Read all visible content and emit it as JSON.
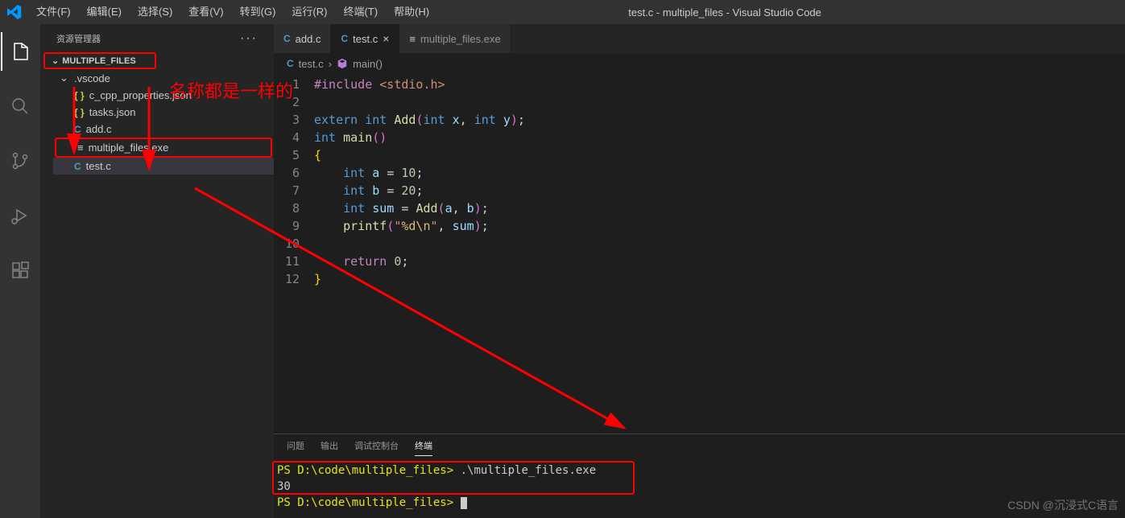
{
  "titlebar": {
    "menu": [
      "文件(F)",
      "编辑(E)",
      "选择(S)",
      "查看(V)",
      "转到(G)",
      "运行(R)",
      "终端(T)",
      "帮助(H)"
    ],
    "title": "test.c - multiple_files - Visual Studio Code"
  },
  "sidebar": {
    "header": "资源管理器",
    "folder": "MULTIPLE_FILES",
    "items": [
      {
        "name": ".vscode",
        "type": "folder"
      },
      {
        "name": "c_cpp_properties.json",
        "type": "json"
      },
      {
        "name": "tasks.json",
        "type": "json"
      },
      {
        "name": "add.c",
        "type": "c"
      },
      {
        "name": "multiple_files.exe",
        "type": "exe"
      },
      {
        "name": "test.c",
        "type": "c"
      }
    ]
  },
  "tabs": [
    {
      "label": "add.c",
      "icon": "c",
      "active": false
    },
    {
      "label": "test.c",
      "icon": "c",
      "active": true
    },
    {
      "label": "multiple_files.exe",
      "icon": "exe",
      "active": false,
      "italic": true
    }
  ],
  "breadcrumb": {
    "file": "test.c",
    "symbol": "main()"
  },
  "code_lines": [
    "1",
    "2",
    "3",
    "4",
    "5",
    "6",
    "7",
    "8",
    "9",
    "10",
    "11",
    "12"
  ],
  "panel": {
    "tabs": [
      "问题",
      "输出",
      "调试控制台",
      "终端"
    ],
    "active": "终端",
    "terminal": {
      "line1_prompt": "PS D:\\code\\multiple_files>",
      "line1_cmd": " .\\multiple_files.exe",
      "line2": "30",
      "line3_prompt": "PS D:\\code\\multiple_files>"
    }
  },
  "annotation_text": "名称都是一样的",
  "watermark": "CSDN @沉浸式C语言"
}
